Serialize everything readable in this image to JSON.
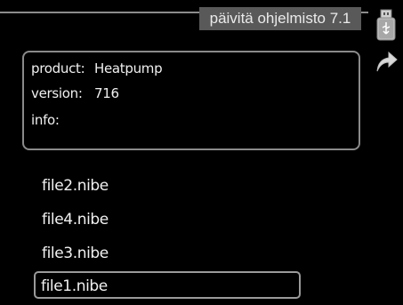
{
  "header": {
    "title": "päivitä ohjelmisto 7.1"
  },
  "icons": {
    "usb": "usb-stick-icon",
    "back": "back-arrow-icon"
  },
  "info_panel": {
    "product_label": "product:",
    "product_value": "Heatpump",
    "version_label": "version:",
    "version_value": "716",
    "info_label": "info:",
    "info_value": ""
  },
  "files": [
    {
      "name": "file2.nibe",
      "selected": false
    },
    {
      "name": "file4.nibe",
      "selected": false
    },
    {
      "name": "file3.nibe",
      "selected": false
    },
    {
      "name": "file1.nibe",
      "selected": true
    }
  ],
  "colors": {
    "background": "#000000",
    "title_bg": "#595959",
    "border": "#8a8a8a",
    "text": "#f2f2f2"
  }
}
